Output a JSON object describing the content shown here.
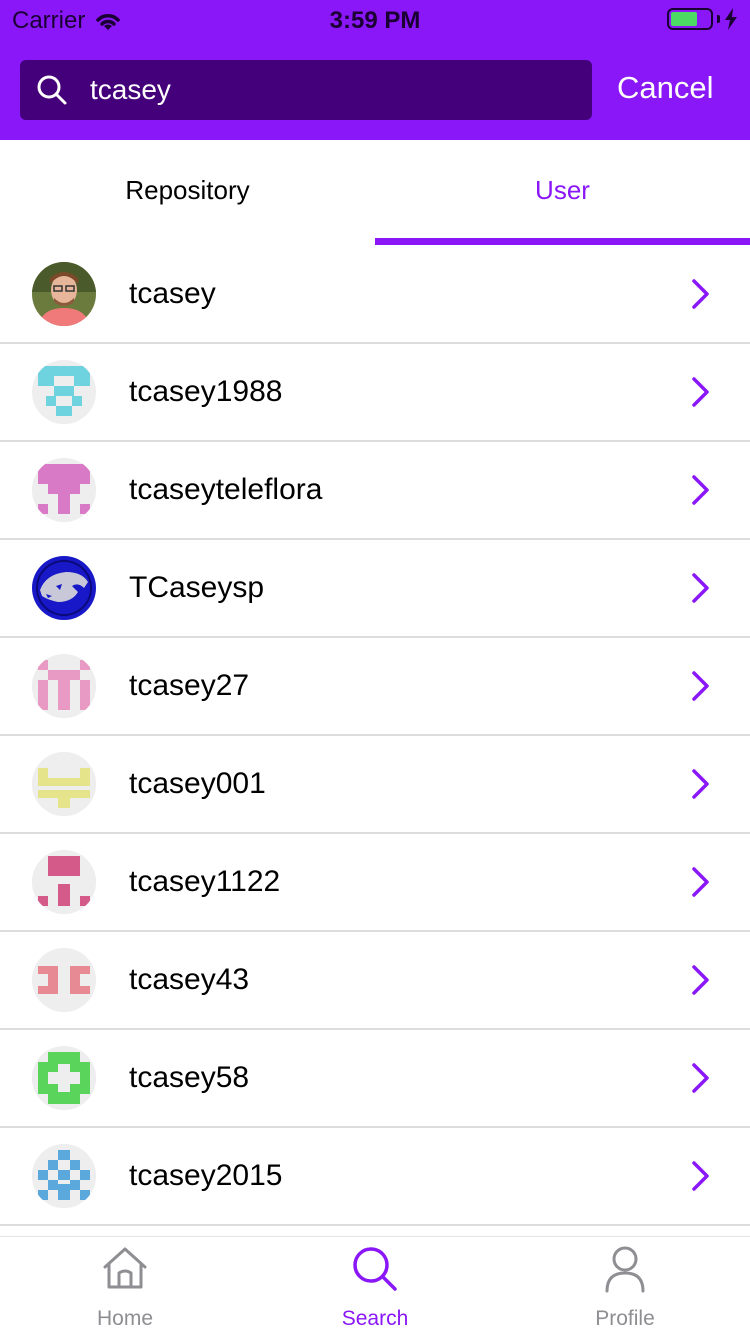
{
  "status_bar": {
    "carrier": "Carrier",
    "time": "3:59 PM"
  },
  "search": {
    "value": "tcasey",
    "cancel_label": "Cancel"
  },
  "tabs": [
    {
      "label": "Repository",
      "active": false
    },
    {
      "label": "User",
      "active": true
    }
  ],
  "users": [
    {
      "name": "tcasey",
      "avatar": "photo"
    },
    {
      "name": "tcasey1988",
      "avatar": "identicon-cyan"
    },
    {
      "name": "tcaseyteleflora",
      "avatar": "identicon-pink"
    },
    {
      "name": "TCaseysp",
      "avatar": "thundercats-logo"
    },
    {
      "name": "tcasey27",
      "avatar": "identicon-lightpink"
    },
    {
      "name": "tcasey001",
      "avatar": "identicon-yellow"
    },
    {
      "name": "tcasey1122",
      "avatar": "identicon-rose"
    },
    {
      "name": "tcasey43",
      "avatar": "identicon-salmon"
    },
    {
      "name": "tcasey58",
      "avatar": "identicon-green"
    },
    {
      "name": "tcasey2015",
      "avatar": "identicon-blue"
    }
  ],
  "tabbar": {
    "home_label": "Home",
    "search_label": "Search",
    "profile_label": "Profile"
  },
  "colors": {
    "accent": "#8a17f7",
    "search_bg": "#44007a",
    "separator": "#dcdcdc",
    "inactive": "#8e8e93"
  }
}
